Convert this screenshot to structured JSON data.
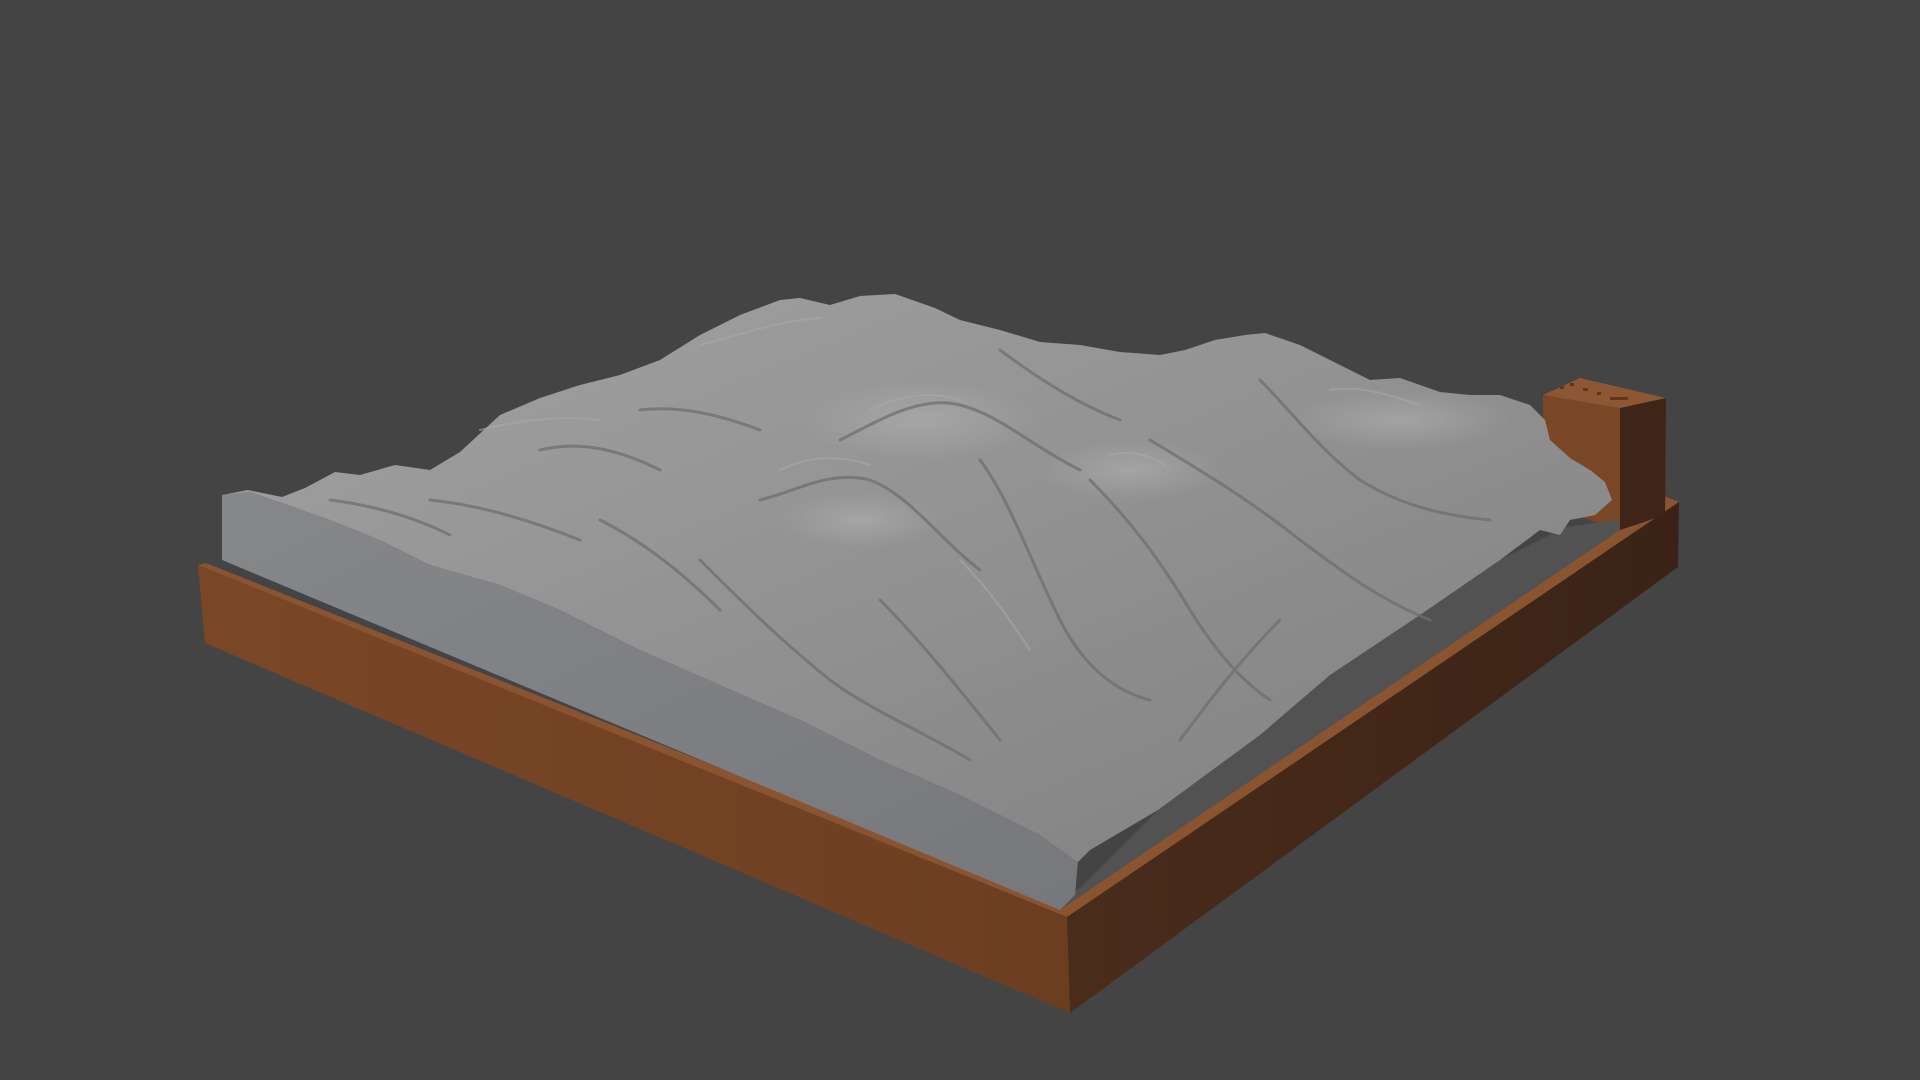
{
  "viewport": {
    "background_color": "#444444"
  },
  "model": {
    "base_color": "#7a4726",
    "base_dark_color": "#3d2517",
    "terrain_color": "#8e8e8e",
    "terrain_side_color": "#7d7e80",
    "terrain_back_color": "#5b5b5b"
  }
}
